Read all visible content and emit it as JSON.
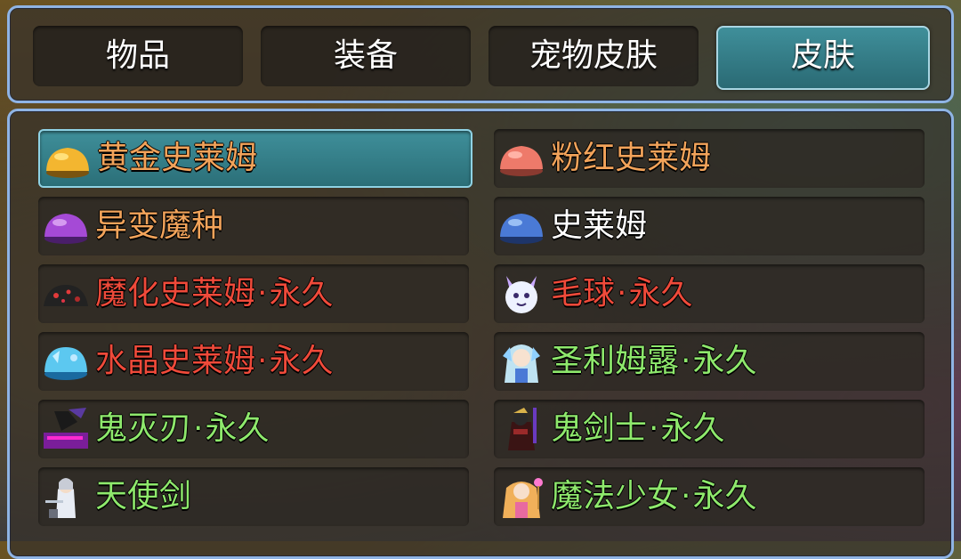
{
  "tabs": [
    {
      "label": "物品",
      "active": false
    },
    {
      "label": "装备",
      "active": false
    },
    {
      "label": "宠物皮肤",
      "active": false
    },
    {
      "label": "皮肤",
      "active": true
    }
  ],
  "colors": {
    "orange": "#f2a35a",
    "white": "#ffffff",
    "red": "#ef4a3a",
    "green": "#8ee86c",
    "accent_border": "#8fb4e4"
  },
  "items": [
    {
      "name": "黄金史莱姆",
      "suffix": "",
      "color": "#f2a35a",
      "icon": "gold-slime-icon",
      "selected": true
    },
    {
      "name": "粉红史莱姆",
      "suffix": "",
      "color": "#f2a35a",
      "icon": "pink-slime-icon",
      "selected": false
    },
    {
      "name": "异变魔种",
      "suffix": "",
      "color": "#f2a35a",
      "icon": "purple-slime-icon",
      "selected": false
    },
    {
      "name": "史莱姆",
      "suffix": "",
      "color": "#ffffff",
      "icon": "blue-slime-icon",
      "selected": false
    },
    {
      "name": "魔化史莱姆",
      "suffix": "永久",
      "color": "#ef4a3a",
      "icon": "dark-slime-icon",
      "selected": false
    },
    {
      "name": "毛球",
      "suffix": "永久",
      "color": "#ef4a3a",
      "icon": "furball-icon",
      "selected": false
    },
    {
      "name": "水晶史莱姆",
      "suffix": "永久",
      "color": "#ef4a3a",
      "icon": "crystal-slime-icon",
      "selected": false
    },
    {
      "name": "圣利姆露",
      "suffix": "永久",
      "color": "#8ee86c",
      "icon": "saint-character-icon",
      "selected": false
    },
    {
      "name": "鬼灭刃",
      "suffix": "永久",
      "color": "#8ee86c",
      "icon": "demon-blade-icon",
      "selected": false
    },
    {
      "name": "鬼剑士",
      "suffix": "永久",
      "color": "#8ee86c",
      "icon": "ghost-swordsman-icon",
      "selected": false
    },
    {
      "name": "天使剑",
      "suffix": "",
      "color": "#8ee86c",
      "icon": "angel-sword-icon",
      "selected": false
    },
    {
      "name": "魔法少女",
      "suffix": "永久",
      "color": "#8ee86c",
      "icon": "magical-girl-icon",
      "selected": false
    }
  ]
}
